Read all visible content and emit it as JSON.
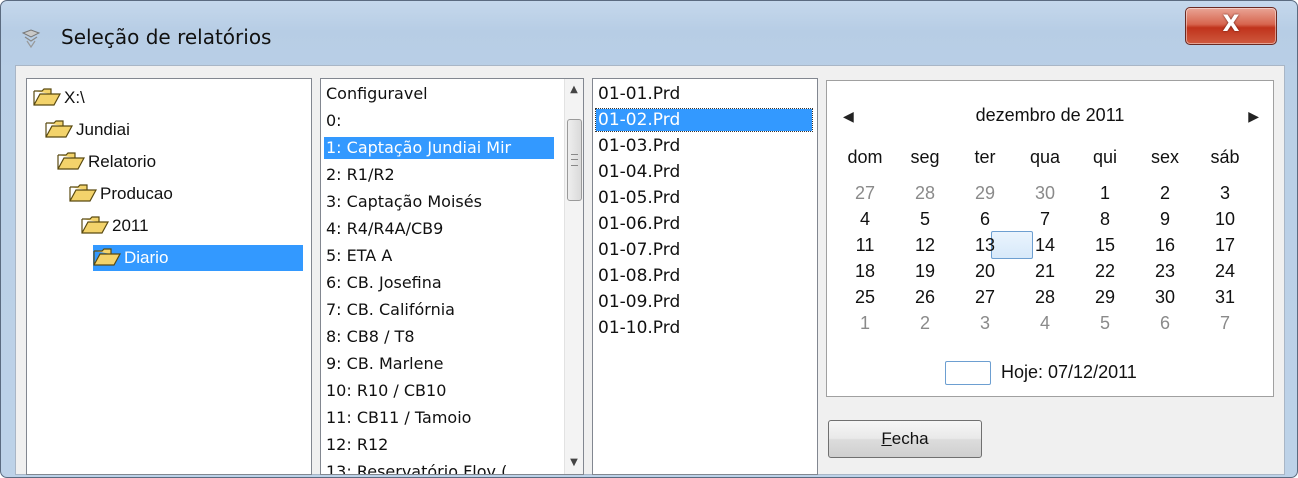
{
  "window": {
    "title": "Seleção de relatórios",
    "close_label": "X"
  },
  "tree": {
    "items": [
      {
        "label": "X:\\",
        "level": 0,
        "selected": false
      },
      {
        "label": "Jundiai",
        "level": 1,
        "selected": false
      },
      {
        "label": "Relatorio",
        "level": 2,
        "selected": false
      },
      {
        "label": "Producao",
        "level": 3,
        "selected": false
      },
      {
        "label": "2011",
        "level": 4,
        "selected": false
      },
      {
        "label": "Diario",
        "level": 5,
        "selected": true
      }
    ]
  },
  "report_list": {
    "items": [
      "Configuravel",
      "0:",
      "1: Captação Jundiai Mir",
      "2: R1/R2",
      "3: Captação Moisés",
      "4: R4/R4A/CB9",
      "5: ETA A",
      "6: CB. Josefina",
      "7: CB. Califórnia",
      "8: CB8 / T8",
      "9: CB. Marlene",
      "10: R10 / CB10",
      "11: CB11 / Tamoio",
      "12: R12",
      "13: Reservatório Flov ("
    ],
    "selected_index": 2
  },
  "file_list": {
    "items": [
      "01-01.Prd",
      "01-02.Prd",
      "01-03.Prd",
      "01-04.Prd",
      "01-05.Prd",
      "01-06.Prd",
      "01-07.Prd",
      "01-08.Prd",
      "01-09.Prd",
      "01-10.Prd"
    ],
    "selected_index": 1
  },
  "calendar": {
    "month_label": "dezembro de 2011",
    "prev_icon": "left-triangle-icon",
    "next_icon": "right-triangle-icon",
    "weekdays": [
      "dom",
      "seg",
      "ter",
      "qua",
      "qui",
      "sex",
      "sáb"
    ],
    "weeks": [
      [
        "27",
        "28",
        "29",
        "30",
        "1",
        "2",
        "3"
      ],
      [
        "4",
        "5",
        "6",
        "7",
        "8",
        "9",
        "10"
      ],
      [
        "11",
        "12",
        "13",
        "14",
        "15",
        "16",
        "17"
      ],
      [
        "18",
        "19",
        "20",
        "21",
        "22",
        "23",
        "24"
      ],
      [
        "25",
        "26",
        "27",
        "28",
        "29",
        "30",
        "31"
      ],
      [
        "1",
        "2",
        "3",
        "4",
        "5",
        "6",
        "7"
      ]
    ],
    "selected_day": "7",
    "today_label": "Hoje: 07/12/2011"
  },
  "buttons": {
    "fecha": "Fecha"
  },
  "colors": {
    "selection": "#3399ff",
    "folder": "#f3d36b",
    "title_bg": "#c5d8ec",
    "close": "#c0331c"
  }
}
